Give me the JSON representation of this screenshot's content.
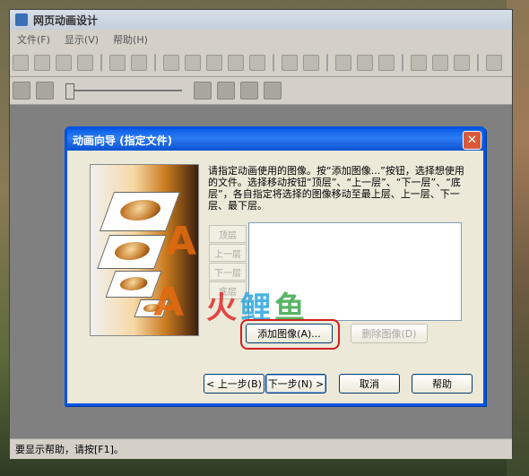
{
  "app": {
    "title": "网页动画设计",
    "menu": [
      "文件(F)",
      "显示(V)",
      "帮助(H)"
    ],
    "status": "要显示帮助，请按[F1]。"
  },
  "toolbar": {
    "icons": [
      "new-icon",
      "open-icon",
      "save-icon",
      "copy-doc-icon",
      "import-icon",
      "stamp-icon",
      "cut-icon",
      "copy-icon",
      "paste-icon",
      "erase-icon",
      "duplicate-icon",
      "undo-icon",
      "redo-icon",
      "props-icon",
      "frame-icon",
      "list-icon",
      "image-icon",
      "image-edit-icon",
      "animate-icon",
      "pen-icon"
    ]
  },
  "dialog": {
    "title": "动画向导 (指定文件)",
    "instructions": "请指定动画使用的图像。按“添加图像...”按钮，选择想使用的文件。选择移动按钮“顶层”、“上一层”、“下一层”、“底层”，各自指定将选择的图像移动至最上层、上一层、下一层、最下层。",
    "order_buttons": [
      "顶层",
      "上一层",
      "下一层",
      "底层"
    ],
    "add_image": "添加图像(A)...",
    "delete_image": "删除图像(D)",
    "back": "< 上一步(B)",
    "next": "下一步(N) >",
    "cancel": "取消",
    "help": "帮助"
  },
  "watermark": [
    "火",
    "鲤",
    "鱼"
  ]
}
